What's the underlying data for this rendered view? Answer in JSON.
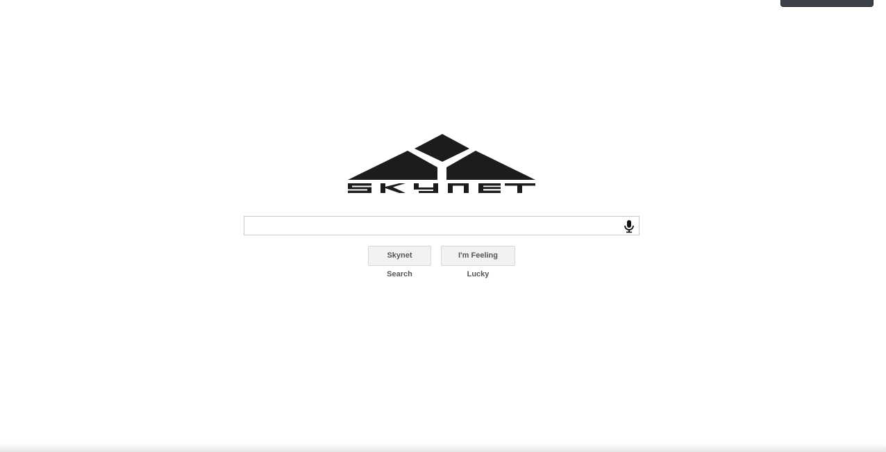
{
  "logo": {
    "text": "Skynet"
  },
  "search": {
    "value": "",
    "placeholder": ""
  },
  "buttons": {
    "search_label": "Skynet Search",
    "lucky_label": "I'm Feeling Lucky"
  },
  "icons": {
    "mic": "microphone-icon"
  },
  "colors": {
    "logo": "#1c1c1c",
    "button_bg": "#f2f2f2",
    "button_text": "#555555",
    "top_tab": "#3d4149"
  }
}
